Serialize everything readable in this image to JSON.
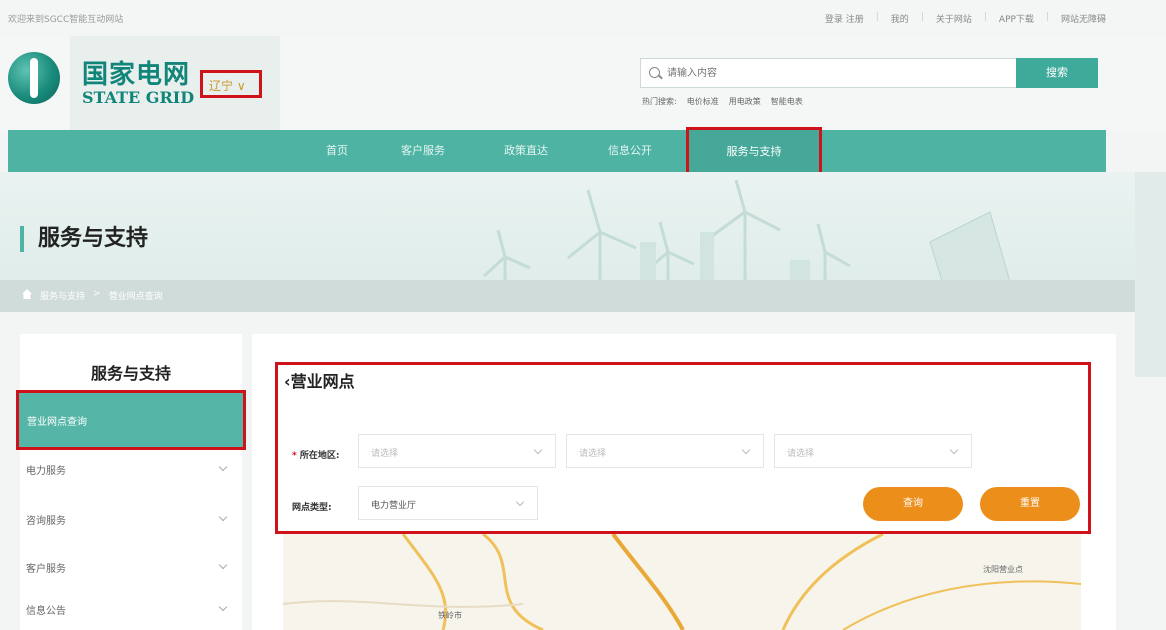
{
  "topbar": {
    "welcome": "欢迎来到SGCC智能互动网站",
    "links": [
      "登录 注册",
      "我的",
      "关于网站",
      "APP下载",
      "网站无障碍"
    ]
  },
  "header": {
    "logo_cn": "国家电网",
    "logo_en": "STATE GRID",
    "region": "辽宁 ∨",
    "search_placeholder": "请输入内容",
    "search_button": "搜索",
    "hot_label": "热门搜索:",
    "hot_terms": [
      "电价标准",
      "用电政策",
      "智能电表"
    ]
  },
  "nav": {
    "items": [
      "首页",
      "客户服务",
      "政策直达",
      "信息公开",
      "服务与支持"
    ]
  },
  "banner": {
    "title": "服务与支持",
    "breadcrumb": [
      "服务与支持",
      ">",
      "营业网点查询"
    ]
  },
  "sidebar": {
    "title": "服务与支持",
    "active": "营业网点查询",
    "items": [
      "电力服务",
      "咨询服务",
      "客户服务",
      "信息公告"
    ]
  },
  "main": {
    "title": "营业网点",
    "region_label": "所在地区:",
    "region_selects": [
      "请选择",
      "请选择",
      "请选择"
    ],
    "type_label": "网点类型:",
    "type_value": "电力营业厅",
    "query_button": "查询",
    "reset_button": "重置",
    "map_labels": [
      "铁岭市",
      "沈阳营业点"
    ]
  },
  "colors": {
    "brand": "#4fb3a4",
    "highlight": "#d0121b",
    "action": "#ec8e1a"
  }
}
